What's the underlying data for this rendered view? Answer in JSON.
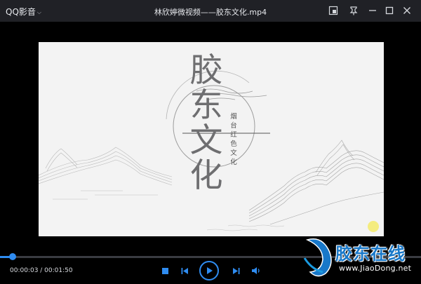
{
  "app": {
    "name": "QQ影音",
    "window_title": "林欣婷微视频——胶东文化.mp4"
  },
  "titlebar": {
    "icons": [
      "pip-icon",
      "pin-icon",
      "minimize-icon",
      "maximize-icon",
      "close-icon"
    ]
  },
  "video": {
    "title": "胶东文化",
    "subtitle": "烟台红色文化"
  },
  "player": {
    "elapsed": "00:00:03",
    "total": "00:01:50",
    "time_display": "00:00:03 / 00:01:50",
    "progress": 0.03,
    "accent": "#2f8cf0"
  },
  "watermark": {
    "text": "胶东在线",
    "url": "www.JiaoDong.net",
    "color": "#1878c9"
  }
}
